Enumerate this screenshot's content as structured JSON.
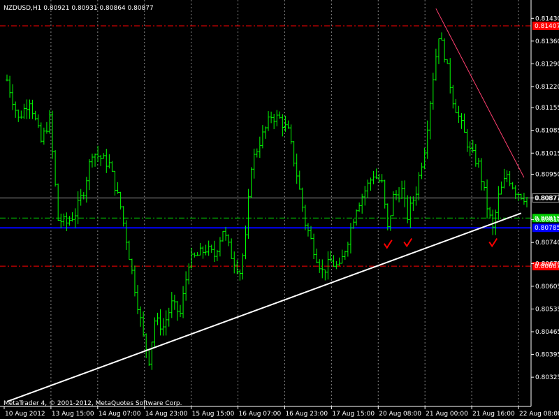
{
  "header": {
    "symbol_label": "NZDUSD,H1  0.80921 0.80931 0.80864 0.80877"
  },
  "footer": {
    "copyright": "MetaTrader 4, © 2001-2012, MetaQuotes Software Corp."
  },
  "colors": {
    "background": "#000000",
    "grid": "#c0c0c0",
    "frame": "#ffffff",
    "bar": "#00ff00",
    "trend_support": "#ffffff",
    "trend_resistance": "#ff3f6f",
    "level_red": "#ff0000",
    "level_green": "#00cc00",
    "level_blue": "#0000ff",
    "level_current": "#a0a0a0",
    "check_mark": "#ff0000"
  },
  "chart_data": {
    "type": "ohlc",
    "symbol": "NZDUSD",
    "timeframe": "H1",
    "ylim": [
      0.80235,
      0.81465
    ],
    "y_ticks": [
      "0.81430",
      "0.81360",
      "0.81290",
      "0.81220",
      "0.81155",
      "0.81085",
      "0.81015",
      "0.80950",
      "0.80877",
      "0.80810",
      "0.80740",
      "0.80675",
      "0.80605",
      "0.80535",
      "0.80465",
      "0.80395",
      "0.80325"
    ],
    "x_ticks": [
      "10 Aug 2012",
      "13 Aug 15:00",
      "14 Aug 07:00",
      "14 Aug 23:00",
      "15 Aug 15:00",
      "16 Aug 07:00",
      "16 Aug 23:00",
      "17 Aug 15:00",
      "20 Aug 08:00",
      "21 Aug 00:00",
      "21 Aug 16:00",
      "22 Aug 08:00"
    ],
    "current_price": "0.80877",
    "levels": [
      {
        "price": 0.81407,
        "label": "0.81407",
        "color": "#ff0000",
        "style": "dashdot"
      },
      {
        "price": 0.80815,
        "label": "0.80815",
        "color": "#00cc00",
        "style": "dashdot"
      },
      {
        "price": 0.80785,
        "label": "0.80785",
        "color": "#0000ff",
        "style": "solid"
      },
      {
        "price": 0.80667,
        "label": "0.80667",
        "color": "#ff0000",
        "style": "dashdot"
      }
    ],
    "trendlines": [
      {
        "name": "support",
        "from": [
          0,
          0.8025
        ],
        "to": [
          181,
          0.8083
        ],
        "color": "#ffffff"
      },
      {
        "name": "resistance",
        "from": [
          151,
          0.8146
        ],
        "to": [
          182,
          0.8094
        ],
        "color": "#ff3f6f"
      }
    ],
    "marks": [
      {
        "bar": 134,
        "price": 0.8073
      },
      {
        "bar": 141,
        "price": 0.80735
      },
      {
        "bar": 171,
        "price": 0.80735
      }
    ],
    "bars_count": 184,
    "close_path": [
      [
        0,
        0.8124
      ],
      [
        4,
        0.8112
      ],
      [
        8,
        0.8118
      ],
      [
        12,
        0.8105
      ],
      [
        15,
        0.8112
      ],
      [
        18,
        0.8081
      ],
      [
        21,
        0.808
      ],
      [
        24,
        0.8083
      ],
      [
        27,
        0.809
      ],
      [
        30,
        0.8102
      ],
      [
        33,
        0.81
      ],
      [
        36,
        0.8098
      ],
      [
        40,
        0.8085
      ],
      [
        43,
        0.807
      ],
      [
        45,
        0.806
      ],
      [
        48,
        0.8045
      ],
      [
        50,
        0.8038
      ],
      [
        52,
        0.805
      ],
      [
        55,
        0.8048
      ],
      [
        58,
        0.8055
      ],
      [
        61,
        0.8052
      ],
      [
        64,
        0.8068
      ],
      [
        67,
        0.807
      ],
      [
        70,
        0.8072
      ],
      [
        73,
        0.807
      ],
      [
        76,
        0.8078
      ],
      [
        79,
        0.807
      ],
      [
        82,
        0.8065
      ],
      [
        84,
        0.8075
      ],
      [
        86,
        0.8098
      ],
      [
        89,
        0.8105
      ],
      [
        93,
        0.8113
      ],
      [
        96,
        0.8112
      ],
      [
        99,
        0.8108
      ],
      [
        102,
        0.8095
      ],
      [
        105,
        0.808
      ],
      [
        108,
        0.8072
      ],
      [
        111,
        0.8065
      ],
      [
        114,
        0.8068
      ],
      [
        117,
        0.8066
      ],
      [
        120,
        0.8075
      ],
      [
        123,
        0.8085
      ],
      [
        126,
        0.809
      ],
      [
        129,
        0.8095
      ],
      [
        132,
        0.8092
      ],
      [
        134,
        0.8078
      ],
      [
        136,
        0.8088
      ],
      [
        139,
        0.809
      ],
      [
        141,
        0.8082
      ],
      [
        144,
        0.809
      ],
      [
        147,
        0.8103
      ],
      [
        150,
        0.8125
      ],
      [
        152,
        0.8138
      ],
      [
        154,
        0.8132
      ],
      [
        157,
        0.8118
      ],
      [
        160,
        0.811
      ],
      [
        163,
        0.8102
      ],
      [
        166,
        0.8098
      ],
      [
        169,
        0.8085
      ],
      [
        171,
        0.8078
      ],
      [
        173,
        0.8088
      ],
      [
        176,
        0.8095
      ],
      [
        179,
        0.809
      ],
      [
        182,
        0.8088
      ],
      [
        183,
        0.80877
      ]
    ]
  }
}
